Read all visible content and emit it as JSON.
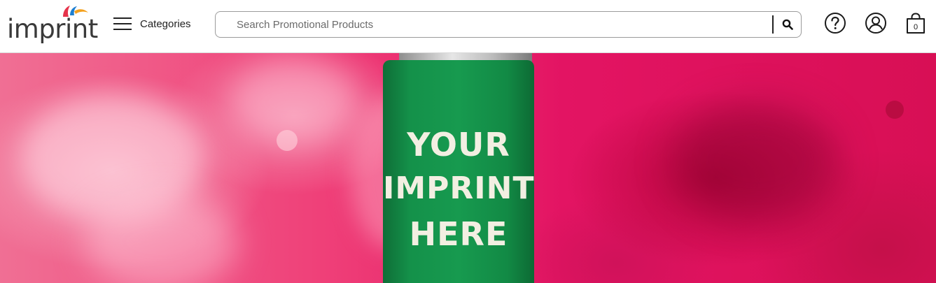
{
  "brand": {
    "logo_text": "imprint",
    "colors": {
      "swoosh_red": "#e6334b",
      "swoosh_blue": "#1d7fd1",
      "swoosh_orange": "#f4a11d",
      "text": "#3a3a3a"
    }
  },
  "header": {
    "menu_icon": "hamburger-icon",
    "menu_label": "Categories",
    "search": {
      "placeholder": "Search Promotional Products",
      "value": "",
      "button_icon": "search-icon"
    },
    "icons": [
      "help-icon",
      "account-icon",
      "cart-icon"
    ],
    "cart_count": "0"
  },
  "hero": {
    "product": "green can cooler",
    "imprint_lines": [
      "YOUR",
      "IMPRINT",
      "HERE"
    ],
    "colors": {
      "background": "#e31463",
      "cooler": "#179a4f",
      "imprint_text": "#f2efe2"
    }
  }
}
